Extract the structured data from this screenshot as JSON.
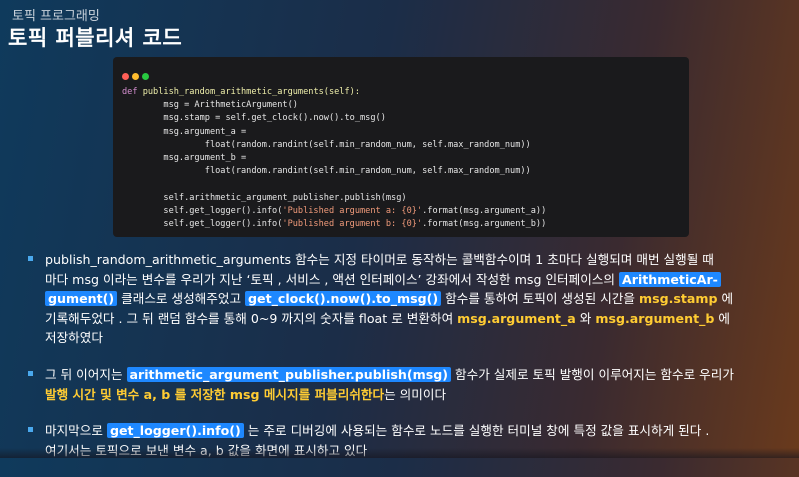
{
  "slide": {
    "category": "토픽 프로그래밍",
    "title": "토픽 퍼블리셔 코드"
  },
  "code": {
    "lines": [
      {
        "segments": [
          {
            "t": "def ",
            "c": "kw"
          },
          {
            "t": "publish_random_arithmetic_arguments(self):",
            "c": "fn"
          }
        ]
      },
      {
        "segments": [
          {
            "t": "        msg = ArithmeticArgument()",
            "c": ""
          }
        ]
      },
      {
        "segments": [
          {
            "t": "        msg.stamp = self.get_clock().now().to_msg()",
            "c": ""
          }
        ]
      },
      {
        "segments": [
          {
            "t": "        msg.argument_a =",
            "c": ""
          }
        ]
      },
      {
        "segments": [
          {
            "t": "                float(random.randint(self.min_random_num, self.max_random_num))",
            "c": ""
          }
        ]
      },
      {
        "segments": [
          {
            "t": "        msg.argument_b =",
            "c": ""
          }
        ]
      },
      {
        "segments": [
          {
            "t": "                float(random.randint(self.min_random_num, self.max_random_num))",
            "c": ""
          }
        ]
      },
      {
        "segments": [
          {
            "t": "",
            "c": ""
          }
        ]
      },
      {
        "segments": [
          {
            "t": "        self.arithmetic_argument_publisher.publish(msg)",
            "c": ""
          }
        ]
      },
      {
        "segments": [
          {
            "t": "        self.get_logger().info(",
            "c": ""
          },
          {
            "t": "'Published argument a: {0}'",
            "c": "str"
          },
          {
            "t": ".format(msg.argument_a))",
            "c": ""
          }
        ]
      },
      {
        "segments": [
          {
            "t": "        self.get_logger().info(",
            "c": ""
          },
          {
            "t": "'Published argument b: {0}'",
            "c": "str"
          },
          {
            "t": ".format(msg.argument_b))",
            "c": ""
          }
        ]
      }
    ]
  },
  "bullets": [
    [
      {
        "t": "publish_random_arithmetic_arguments  함수는 지정 타이머로 동작하는 콜백함수이며  1 초마다 실행되며 매번 실행될 때 ",
        "s": ""
      },
      {
        "br": true
      },
      {
        "t": "마다  msg  이라는 변수를 우리가 지난 ‘토픽 , 서비스 , 액션 인터페이스’ 강좌에서 작성한  msg  인터페이스의 ",
        "s": ""
      },
      {
        "t": "ArithmeticAr-",
        "s": "hl"
      },
      {
        "br": true
      },
      {
        "t": "gument()",
        "s": "hl"
      },
      {
        "t": " 클래스로 생성해주었고  ",
        "s": ""
      },
      {
        "t": "get_clock().now().to_msg()",
        "s": "hl"
      },
      {
        "t": "  함수를 통하여 토픽이 생성된 시간을  ",
        "s": ""
      },
      {
        "t": "msg.stamp",
        "s": "yl"
      },
      {
        "t": " 에 ",
        "s": ""
      },
      {
        "br": true
      },
      {
        "t": "기록해두었다 .  그 뒤 랜덤 함수를 통해   0~9 까지의 숫자를   float 로 변환하여  ",
        "s": ""
      },
      {
        "t": "msg.argument_a",
        "s": "yl"
      },
      {
        "t": "  와   ",
        "s": ""
      },
      {
        "t": "msg.argument_b",
        "s": "yl"
      },
      {
        "t": "  에 ",
        "s": ""
      },
      {
        "br": true
      },
      {
        "t": "저장하였다",
        "s": ""
      }
    ],
    [
      {
        "t": "그 뒤 이어지는  ",
        "s": ""
      },
      {
        "t": "arithmetic_argument_publisher.publish(msg)",
        "s": "hl"
      },
      {
        "t": "  함수가 실제로 토픽 발행이 이루어지는 함수로 우리가 ",
        "s": ""
      },
      {
        "br": true
      },
      {
        "t": "발행 시간 및 변수   a, b 를 저장한   msg   메시지를 퍼블리쉬한다",
        "s": "yl"
      },
      {
        "t": "는 의미이다",
        "s": ""
      }
    ],
    [
      {
        "t": "마지막으로  ",
        "s": ""
      },
      {
        "t": "get_logger().info()",
        "s": "hl"
      },
      {
        "t": " 는 주로 디버깅에 사용되는 함수로 노드를 실행한 터미널 창에 특정 값을 표시하게 된다 . ",
        "s": ""
      },
      {
        "br": true
      },
      {
        "t": "여기서는 토픽으로 보낸 변수  a,  b  값을 화면에 표시하고 있다",
        "s": ""
      }
    ]
  ]
}
